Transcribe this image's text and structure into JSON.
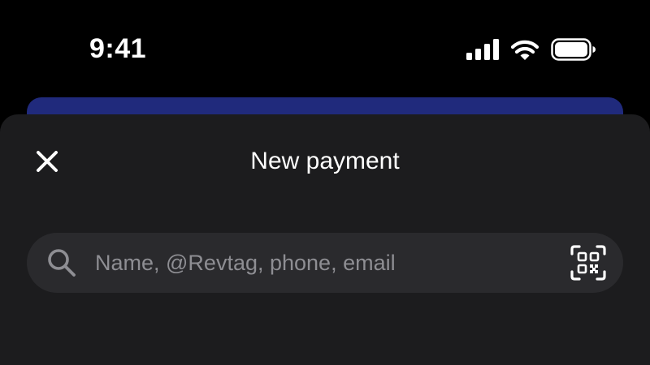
{
  "status_bar": {
    "time": "9:41",
    "signal_icon": "cellular-signal-icon",
    "wifi_icon": "wifi-icon",
    "battery_icon": "battery-icon"
  },
  "sheet": {
    "title": "New payment",
    "close_icon": "close-icon"
  },
  "search": {
    "value": "",
    "placeholder": "Name, @Revtag, phone, email",
    "search_icon": "search-icon",
    "qr_icon": "qr-code-scan-icon"
  },
  "colors": {
    "background": "#000000",
    "sheet": "#1c1c1e",
    "search_field": "#2a2a2d",
    "placeholder": "#8e8e93",
    "behind_card": "#202a7c",
    "text": "#ffffff"
  }
}
